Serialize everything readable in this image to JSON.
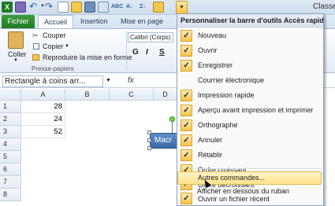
{
  "window": {
    "title": "Classeu"
  },
  "tabs": {
    "file": "Fichier",
    "home": "Accueil",
    "insert": "Insertion",
    "layout": "Mise en page"
  },
  "clipboard": {
    "paste": "Coller",
    "cut": "Couper",
    "copy": "Copier",
    "format_painter": "Reproduire la mise en forme",
    "group_label": "Presse-papiers"
  },
  "font": {
    "name": "Calibri (Corps)",
    "bold": "G",
    "italic": "I",
    "underline": "S"
  },
  "formula_bar": {
    "name_box": "Rectangle à coins arr...",
    "fx": "fx"
  },
  "grid": {
    "columns": [
      "A",
      "B",
      "C",
      "D"
    ],
    "rows": [
      "1",
      "2",
      "3",
      "4",
      "5",
      "6",
      "7",
      "8"
    ],
    "cells": {
      "A1": "28",
      "A2": "24",
      "A3": "52"
    }
  },
  "shape": {
    "text": "Macr"
  },
  "menu": {
    "title": "Personnaliser la barre d'outils Accès rapide",
    "items": [
      {
        "label": "Nouveau",
        "checked": true
      },
      {
        "label": "Ouvrir",
        "checked": true
      },
      {
        "label": "Enregistrer",
        "checked": true
      },
      {
        "label": "Courrier électronique",
        "checked": false
      },
      {
        "label": "Impression rapide",
        "checked": true
      },
      {
        "label": "Aperçu avant impression et imprimer",
        "checked": true
      },
      {
        "label": "Orthographe",
        "checked": true
      },
      {
        "label": "Annuler",
        "checked": true
      },
      {
        "label": "Rétablir",
        "checked": true
      },
      {
        "label": "Ordre croissant",
        "checked": true
      },
      {
        "label": "Ordre décroissant",
        "checked": true
      },
      {
        "label": "Ouvrir un fichier récent",
        "checked": true
      }
    ],
    "more_commands": "Autres commandes...",
    "show_below": "Afficher en dessous du ruban"
  },
  "colors": {
    "accent": "#1f7a1f",
    "highlight": "#ffe38c",
    "shape_fill": "#4a7bb7"
  }
}
